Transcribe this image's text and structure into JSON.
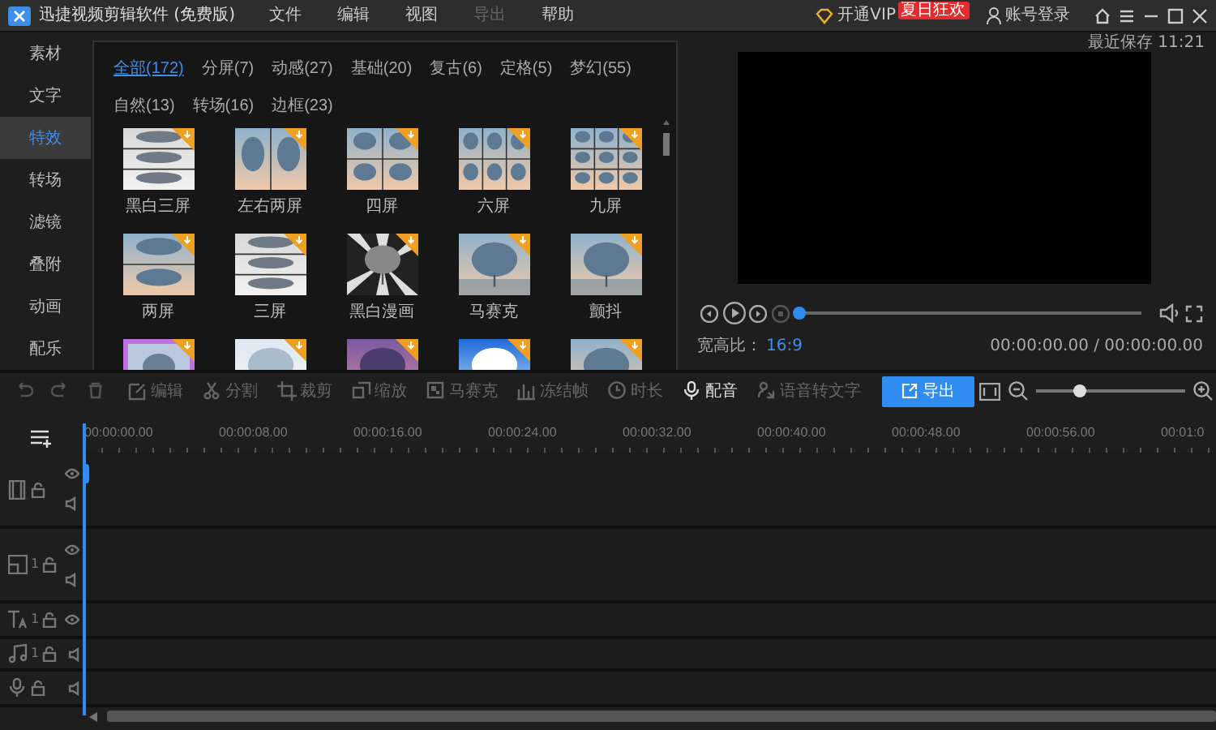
{
  "title_bar": {
    "app_title": "迅捷视频剪辑软件 (免费版)",
    "menus": [
      {
        "label": "文件",
        "disabled": false
      },
      {
        "label": "编辑",
        "disabled": false
      },
      {
        "label": "视图",
        "disabled": false
      },
      {
        "label": "导出",
        "disabled": true
      },
      {
        "label": "帮助",
        "disabled": false
      }
    ],
    "vip": {
      "label": "开通VIP",
      "badge": "夏日狂欢"
    },
    "login": "账号登录"
  },
  "sidebar": {
    "items": [
      {
        "label": "素材",
        "selected": false
      },
      {
        "label": "文字",
        "selected": false
      },
      {
        "label": "特效",
        "selected": true
      },
      {
        "label": "转场",
        "selected": false
      },
      {
        "label": "滤镜",
        "selected": false
      },
      {
        "label": "叠附",
        "selected": false
      },
      {
        "label": "动画",
        "selected": false
      },
      {
        "label": "配乐",
        "selected": false
      }
    ]
  },
  "effects": {
    "categories": [
      {
        "label": "全部(172)",
        "selected": true
      },
      {
        "label": "分屏(7)",
        "selected": false
      },
      {
        "label": "动感(27)",
        "selected": false
      },
      {
        "label": "基础(20)",
        "selected": false
      },
      {
        "label": "复古(6)",
        "selected": false
      },
      {
        "label": "定格(5)",
        "selected": false
      },
      {
        "label": "梦幻(55)",
        "selected": false
      },
      {
        "label": "自然(13)",
        "selected": false
      },
      {
        "label": "转场(16)",
        "selected": false
      },
      {
        "label": "边框(23)",
        "selected": false
      }
    ],
    "items": [
      {
        "label": "黑白三屏",
        "kind": "stack3",
        "downloaded": false
      },
      {
        "label": "左右两屏",
        "kind": "side2",
        "downloaded": false
      },
      {
        "label": "四屏",
        "kind": "grid4",
        "downloaded": false
      },
      {
        "label": "六屏",
        "kind": "grid6",
        "downloaded": false
      },
      {
        "label": "九屏",
        "kind": "grid9",
        "downloaded": false
      },
      {
        "label": "两屏",
        "kind": "stack2",
        "downloaded": false
      },
      {
        "label": "三屏",
        "kind": "stack3",
        "downloaded": false
      },
      {
        "label": "黑白漫画",
        "kind": "burst",
        "downloaded": false
      },
      {
        "label": "马赛克",
        "kind": "single",
        "downloaded": false
      },
      {
        "label": "颤抖",
        "kind": "single",
        "downloaded": false
      },
      {
        "kind": "frame",
        "downloaded": false
      },
      {
        "kind": "fade",
        "downloaded": false
      },
      {
        "kind": "dusk",
        "downloaded": false
      },
      {
        "kind": "flare",
        "downloaded": false
      },
      {
        "kind": "single",
        "downloaded": false
      }
    ]
  },
  "preview": {
    "saved_at": "最近保存 11:21",
    "progress": {
      "level": 0
    },
    "aspect_label": "宽高比：",
    "aspect_value": "16:9",
    "time": "00:00:00.00 / 00:00:00.00"
  },
  "toolbar": {
    "history": [
      {
        "kind": "undo",
        "disabled": true
      },
      {
        "kind": "redo",
        "disabled": true
      },
      {
        "kind": "delete",
        "disabled": true
      }
    ],
    "tools": [
      {
        "kind": "edit",
        "label": "编辑",
        "disabled": true
      },
      {
        "kind": "split",
        "label": "分割",
        "disabled": true
      },
      {
        "kind": "crop",
        "label": "裁剪",
        "disabled": true
      },
      {
        "kind": "scale",
        "label": "缩放",
        "disabled": true
      },
      {
        "kind": "mosaic",
        "label": "马赛克",
        "disabled": true
      },
      {
        "kind": "freeze",
        "label": "冻结帧",
        "disabled": true
      },
      {
        "kind": "duration",
        "label": "时长",
        "disabled": true
      },
      {
        "kind": "voiceover",
        "label": "配音",
        "disabled": false
      },
      {
        "kind": "speech",
        "label": "语音转文字",
        "disabled": true
      }
    ],
    "export": "导出",
    "zoom": {
      "level": 0.3
    }
  },
  "ruler": [
    "00:00:00.00",
    "00:00:08.00",
    "00:00:16.00",
    "00:00:24.00",
    "00:00:32.00",
    "00:00:40.00",
    "00:00:48.00",
    "00:00:56.00",
    "00:01:0"
  ],
  "tracks": [
    {
      "kind": "video"
    },
    {
      "kind": "overlay",
      "count": "1"
    },
    {
      "kind": "text",
      "count": "1"
    },
    {
      "kind": "music",
      "count": "1"
    },
    {
      "kind": "voice"
    }
  ]
}
